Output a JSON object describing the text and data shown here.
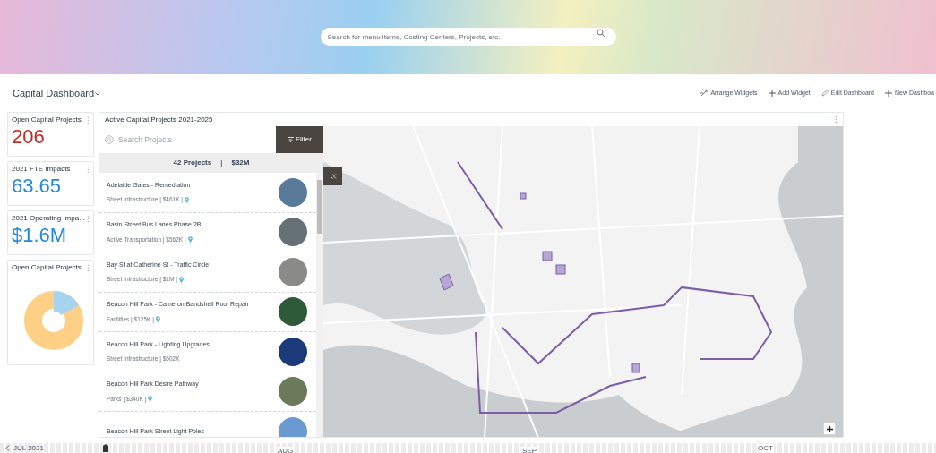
{
  "search": {
    "placeholder": "Search for menu items, Costing Centers, Projects, etc."
  },
  "dashboard": {
    "title": "Capital Dashboard"
  },
  "actions": [
    {
      "label": "Arrange Widgets",
      "kind": "arrange"
    },
    {
      "label": "Add Widget",
      "kind": "add"
    },
    {
      "label": "Edit Dashboard",
      "kind": "edit"
    },
    {
      "label": "New Dashboa",
      "kind": "add"
    }
  ],
  "kpis": [
    {
      "title": "Open Capital Projects",
      "value": "206",
      "color": "#c62828"
    },
    {
      "title": "2021 FTE Impacts",
      "value": "63.65",
      "color": "#1e88e5"
    },
    {
      "title": "2021 Operating Impa...",
      "value": "$1.6M",
      "color": "#1e88e5"
    }
  ],
  "donut_widget": {
    "title": "Open Capital Projects"
  },
  "projects_panel": {
    "title": "Active Capital Projects 2021-2025",
    "search_placeholder": "Search Projects",
    "filter_label": "Filter",
    "count": "42 Projects",
    "separator": "|",
    "total": "$32M",
    "items": [
      {
        "name": "Adelaide Gates - Remediation",
        "detail": "Street Infrastructure | $461K |",
        "has_location": true
      },
      {
        "name": "Basin Street Bus Lanes Phase 2B",
        "detail": "Active Transportation | $562K |",
        "has_location": true
      },
      {
        "name": "Bay St at Catherine St - Traffic Circle",
        "detail": "Street Infrastructure | $1M |",
        "has_location": true
      },
      {
        "name": "Beacon Hill Park - Cameron Bandshell Roof Repair",
        "detail": "Facilities | $125K |",
        "has_location": true
      },
      {
        "name": "Beacon Hill Park - Lighting Upgrades",
        "detail": "Street Infrastructure | $602K",
        "has_location": false
      },
      {
        "name": "Beacon Hill Park Desire Pathway",
        "detail": "Parks | $340K |",
        "has_location": true
      },
      {
        "name": "Beacon Hill Park Street Light Poles",
        "has_location": false
      }
    ]
  },
  "timeline": {
    "labels": [
      "JUL 2021",
      "AUG",
      "SEP",
      "OCT"
    ]
  }
}
